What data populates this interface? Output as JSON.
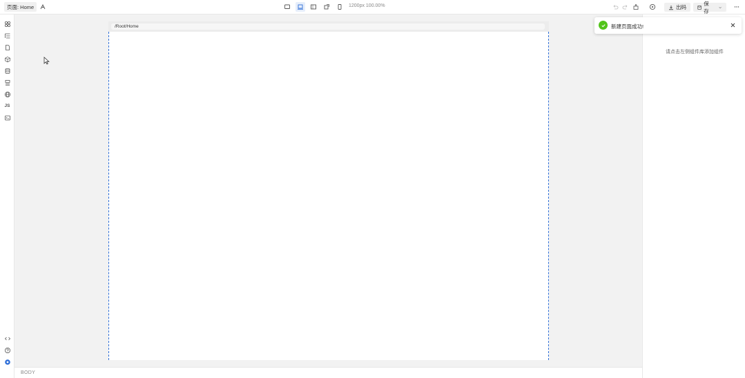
{
  "toolbar": {
    "page_label": "页面: Home",
    "viewport": "1200px  100.00%",
    "export_label": "出码",
    "save_label": "保存"
  },
  "canvas": {
    "route": "/Root/Home"
  },
  "right_panel": {
    "empty_hint": "请点击左侧组件库添加组件"
  },
  "toast": {
    "message": "新建页面成功!"
  },
  "status_bar": {
    "path": "BODY"
  },
  "left_rail": {
    "js_label": "JS"
  },
  "colors": {
    "accent": "#2f6fd8",
    "success": "#52c41a"
  }
}
